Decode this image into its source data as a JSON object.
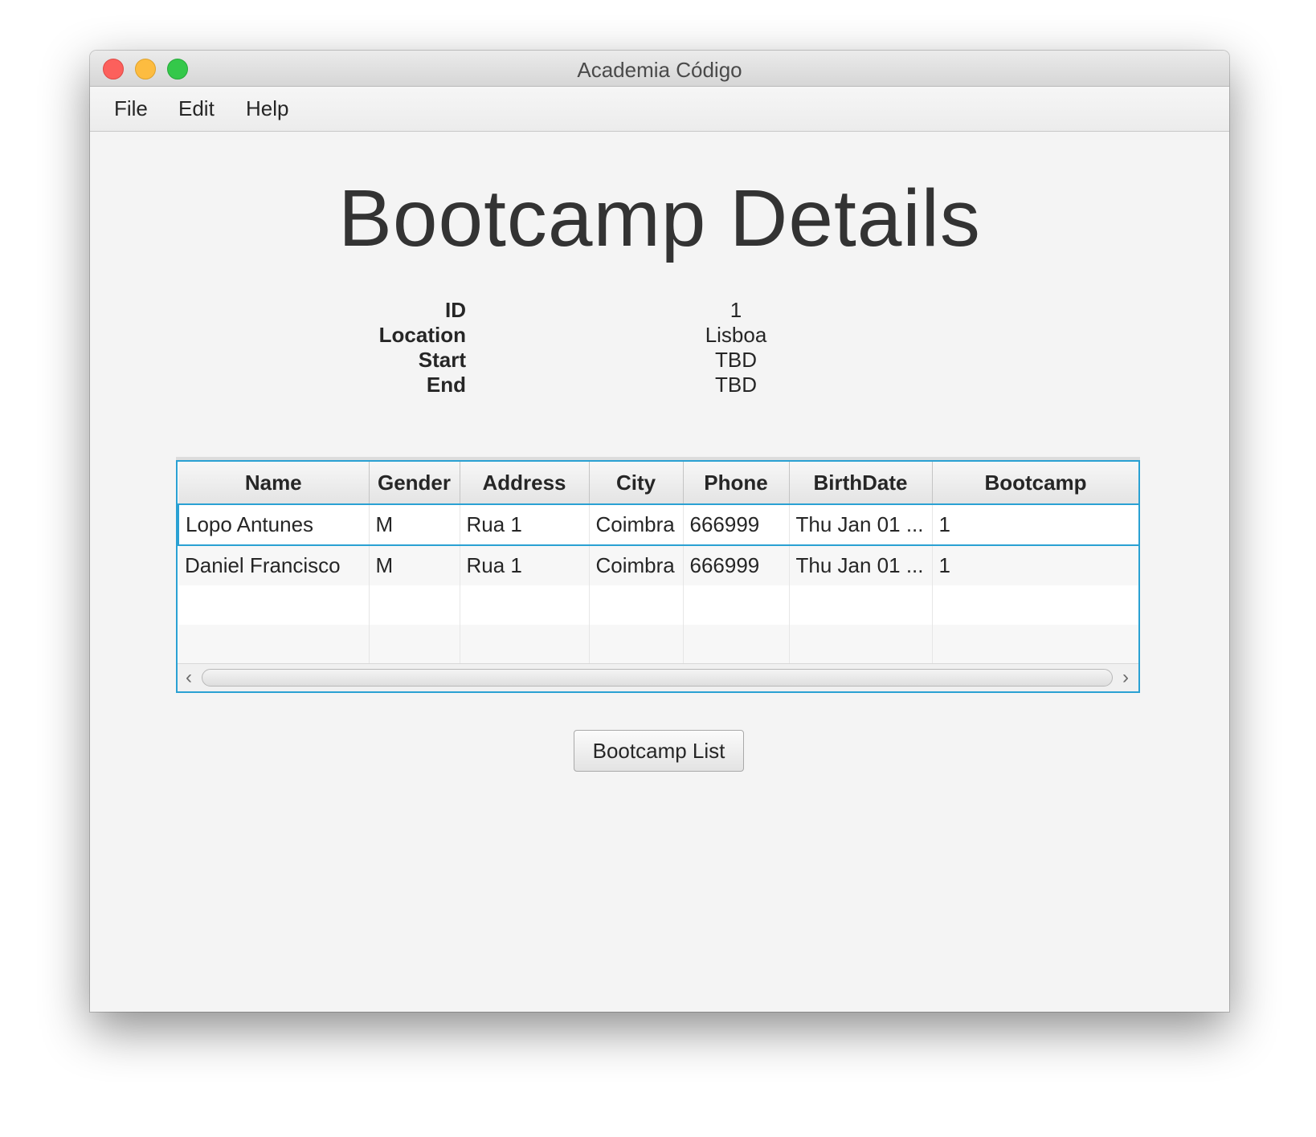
{
  "window": {
    "title": "Academia Código"
  },
  "menu": [
    "File",
    "Edit",
    "Help"
  ],
  "page": {
    "title": "Bootcamp Details"
  },
  "details": [
    {
      "label": "ID",
      "value": "1"
    },
    {
      "label": "Location",
      "value": "Lisboa"
    },
    {
      "label": "Start",
      "value": "TBD"
    },
    {
      "label": "End",
      "value": "TBD"
    }
  ],
  "table": {
    "columns": [
      "Name",
      "Gender",
      "Address",
      "City",
      "Phone",
      "BirthDate",
      "Bootcamp"
    ],
    "rows": [
      [
        "Lopo Antunes",
        "M",
        "Rua 1",
        "Coimbra",
        "666999",
        "Thu Jan 01 ...",
        "1"
      ],
      [
        "Daniel Francisco",
        "M",
        "Rua 1",
        "Coimbra",
        "666999",
        "Thu Jan 01 ...",
        "1"
      ]
    ],
    "selected_row": 0
  },
  "buttons": {
    "bootcamp_list": "Bootcamp List"
  },
  "icons": {
    "close": "close-icon",
    "minimize": "minimize-icon",
    "maximize": "maximize-icon",
    "scroll_left": "chevron-left-icon",
    "scroll_right": "chevron-right-icon"
  },
  "colors": {
    "selection": "#2aa1d3",
    "close": "#fc605c",
    "minimize": "#fdbc40",
    "maximize": "#34c84a"
  }
}
